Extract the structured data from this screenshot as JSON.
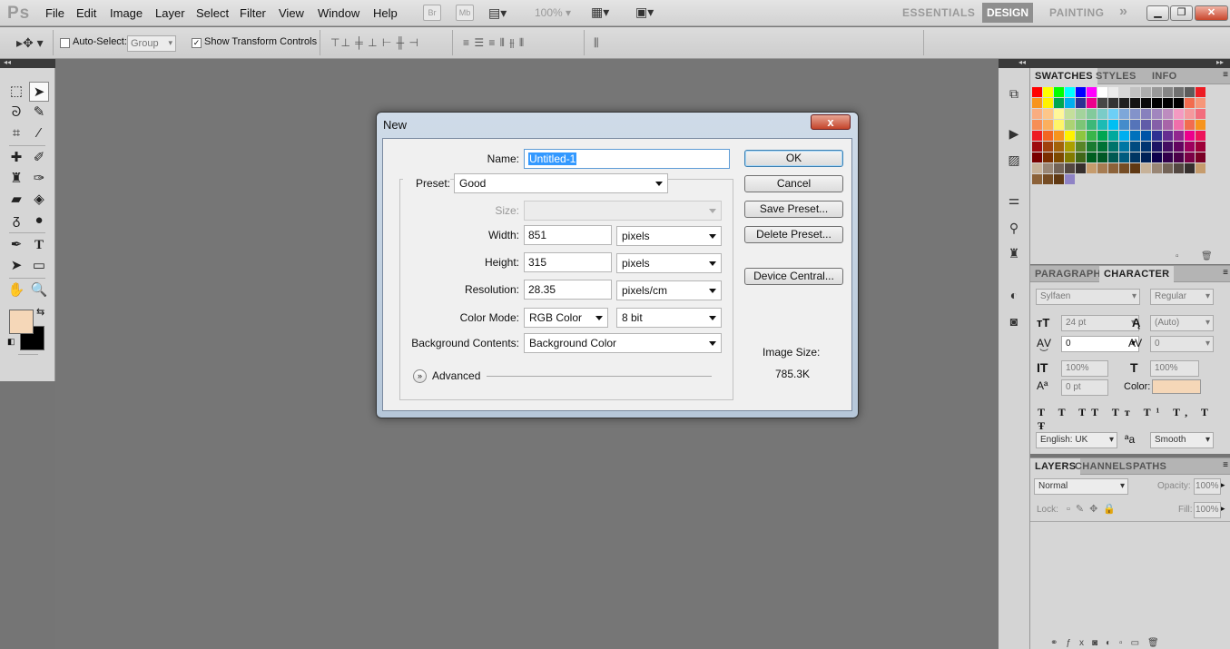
{
  "menubar": {
    "logo": "Ps",
    "menus": [
      "File",
      "Edit",
      "Image",
      "Layer",
      "Select",
      "Filter",
      "View",
      "Window",
      "Help"
    ],
    "bridge": "Br",
    "minibridge": "Mb",
    "zoom": "100%",
    "workspaces": [
      "ESSENTIALS",
      "DESIGN",
      "PAINTING"
    ],
    "active_workspace": "DESIGN",
    "more": "»"
  },
  "options": {
    "auto_select_label": "Auto-Select:",
    "auto_select_value": "Group",
    "show_transform_label": "Show Transform Controls",
    "show_transform_checked": "✓"
  },
  "dialog": {
    "title": "New",
    "close": "x",
    "name_label": "Name:",
    "name_value": "Untitled-1",
    "preset_label": "Preset:",
    "preset_value": "Good",
    "size_label": "Size:",
    "width_label": "Width:",
    "width_value": "851",
    "width_unit": "pixels",
    "height_label": "Height:",
    "height_value": "315",
    "height_unit": "pixels",
    "resolution_label": "Resolution:",
    "resolution_value": "28.35",
    "resolution_unit": "pixels/cm",
    "color_mode_label": "Color Mode:",
    "color_mode_value": "RGB Color",
    "bit_depth": "8 bit",
    "bg_label": "Background Contents:",
    "bg_value": "Background Color",
    "advanced_label": "Advanced",
    "buttons": {
      "ok": "OK",
      "cancel": "Cancel",
      "save": "Save Preset...",
      "delete": "Delete Preset...",
      "device": "Device Central..."
    },
    "image_size_label": "Image Size:",
    "image_size_value": "785.3K"
  },
  "swatches": {
    "tabs": [
      "SWATCHES",
      "STYLES",
      "INFO"
    ],
    "colors": [
      "#ff0000",
      "#ffff00",
      "#00ff00",
      "#00ffff",
      "#0000ff",
      "#ff00ff",
      "#ffffff",
      "#ebebeb",
      "#d6d6d6",
      "#c2c2c2",
      "#adadad",
      "#999999",
      "#858585",
      "#707070",
      "#5c5c5c",
      "#ed1c24",
      "#f7941d",
      "#fff200",
      "#00a651",
      "#00aeef",
      "#2e3192",
      "#ec008c",
      "#474747",
      "#333333",
      "#1f1f1f",
      "#141414",
      "#0a0a0a",
      "#000000",
      "#000000",
      "#000000",
      "#f26c4f",
      "#f69679",
      "#f9ad81",
      "#fdc689",
      "#fff799",
      "#c4df9b",
      "#a3d39c",
      "#82ca9c",
      "#7accc8",
      "#6dcff6",
      "#7da7d9",
      "#8393ca",
      "#8781bd",
      "#a186be",
      "#bd8cbf",
      "#f49ac1",
      "#f5989d",
      "#f26d7d",
      "#f68e56",
      "#fbaf5d",
      "#fff568",
      "#acd373",
      "#7cc576",
      "#3cb878",
      "#1cbbb4",
      "#00bff3",
      "#448ccb",
      "#5574b9",
      "#605ca8",
      "#855fa8",
      "#a864a8",
      "#f06eaa",
      "#f26c4f",
      "#f7941d",
      "#ed1c24",
      "#f26522",
      "#f7941d",
      "#fff200",
      "#8dc63f",
      "#39b54a",
      "#00a651",
      "#00a99d",
      "#00aeef",
      "#0072bc",
      "#0054a6",
      "#2e3192",
      "#662d91",
      "#92278f",
      "#ec008c",
      "#ed145b",
      "#9e0b0f",
      "#a0410d",
      "#a36209",
      "#aba000",
      "#598527",
      "#1a7b30",
      "#007236",
      "#00746b",
      "#0076a3",
      "#004b80",
      "#003471",
      "#1b1464",
      "#440e62",
      "#630460",
      "#9e005d",
      "#9e0039",
      "#790000",
      "#7b2e00",
      "#7d4900",
      "#827b00",
      "#406618",
      "#005e20",
      "#005826",
      "#005952",
      "#005b7f",
      "#003663",
      "#002157",
      "#0d004c",
      "#32004b",
      "#4b0049",
      "#7b0046",
      "#7a0026",
      "#c7b299",
      "#998675",
      "#736357",
      "#534741",
      "#362f2d",
      "#c69c6d",
      "#a67c52",
      "#8c6239",
      "#754c24",
      "#603913",
      "#c7b299",
      "#998675",
      "#736357",
      "#534741",
      "#362f2d",
      "#c69c6d",
      "#8c6239",
      "#754c24",
      "#603913",
      "#8f83c5"
    ]
  },
  "character": {
    "tabs": [
      "PARAGRAPH",
      "CHARACTER"
    ],
    "font": "Sylfaen",
    "style": "Regular",
    "size": "24 pt",
    "leading": "(Auto)",
    "kerning": "0",
    "tracking": "0",
    "vscale": "100%",
    "hscale": "100%",
    "baseline": "0 pt",
    "color_label": "Color:",
    "color": "#f5d7b8",
    "language": "English: UK",
    "aa_label": "a",
    "antialias": "Smooth"
  },
  "layers": {
    "tabs": [
      "LAYERS",
      "CHANNELS",
      "PATHS"
    ],
    "blend": "Normal",
    "opacity_label": "Opacity:",
    "opacity": "100%",
    "lock_label": "Lock:",
    "fill_label": "Fill:",
    "fill": "100%"
  },
  "colors": {
    "foreground": "#f5d7b8",
    "background": "#000000"
  }
}
